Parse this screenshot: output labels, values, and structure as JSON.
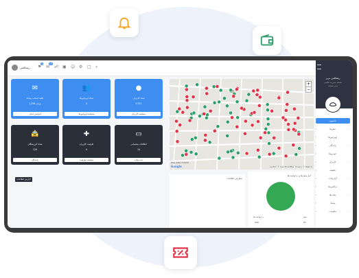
{
  "colors": {
    "accent": "#3d8ef0",
    "dark_tile": "#2b2f3a",
    "icon_orange": "#f5a623",
    "icon_green": "#2e9e6b",
    "icon_red": "#e0344b",
    "pie_green": "#34a853"
  },
  "floating_icons": [
    "bell-icon",
    "wallet-icon",
    "discount-ticket-icon"
  ],
  "topbar": {
    "user_name": "ريشاقس",
    "badge1": "4",
    "badge2": "10"
  },
  "tiles": [
    {
      "title": "باقية حساب رسانة",
      "value": "1,256 تومان",
      "foot": "افزایش اعتبار",
      "icon": "mail-icon"
    },
    {
      "title": "تعداد اوپراتورها",
      "value": "4",
      "foot": "مشاهده اوپراتورها",
      "icon": "users-icon"
    },
    {
      "title": "تعداد کاربران",
      "value": "3,521",
      "foot": "مشاهده کاربران",
      "icon": "user-icon"
    },
    {
      "title": "تعداد کرزیشگان",
      "value": "120",
      "foot": "رانندگان",
      "icon": "taxi-icon"
    },
    {
      "title": "ظرفیت کاربران",
      "value": "0",
      "foot": "مشاهده ظرفیت",
      "icon": "medical-box-icon"
    },
    {
      "title": "اطلاعات پشتیبانی",
      "value": "14",
      "foot": "ثبت تیکت",
      "icon": "chat-icon"
    }
  ],
  "map": {
    "attribution": "Leaflet | © OpenStreetMap, Imagery © Mapbox",
    "google": "Google",
    "scale": "Map data ©2018",
    "zoom_in": "+",
    "zoom_out": "−"
  },
  "report_button": "گزارش اطلاعات",
  "panels": {
    "orders_title": "سفارش اطلاعات",
    "chart_title": "آمار سفرها و درخواست‌ها"
  },
  "chart_data": {
    "type": "pie",
    "title": "آمار سفرها و درخواست‌ها",
    "series": [
      {
        "name": "درخواست‌ها",
        "values": [
          100
        ]
      }
    ],
    "legend": [
      "درخواست‌ها",
      "سفر"
    ],
    "footer": [
      "200",
      "75۰"
    ]
  },
  "sidebar": {
    "brand": "ریشاقس مریز",
    "sub1": "سامانه مدیریت تاکسی",
    "sub2": "مدیر سامانه",
    "items": [
      {
        "label": "داشبورد",
        "icon": "dashboard-icon"
      },
      {
        "label": "سفرها",
        "icon": "trips-icon"
      },
      {
        "label": "اوپراتورها",
        "icon": "operators-icon"
      },
      {
        "label": "رانندگان",
        "icon": "drivers-icon"
      },
      {
        "label": "خودروها",
        "icon": "cars-icon"
      },
      {
        "label": "کاربران",
        "icon": "users-icon"
      },
      {
        "label": "تخفیف",
        "icon": "discount-icon"
      },
      {
        "label": "گزارشات",
        "icon": "report-icon"
      },
      {
        "label": "تراکنش‌ها",
        "icon": "transactions-icon"
      },
      {
        "label": "تیکت‌ها",
        "icon": "tickets-icon"
      },
      {
        "label": "پیامک",
        "icon": "sms-icon"
      },
      {
        "label": "تنظیمات",
        "icon": "settings-icon"
      }
    ]
  }
}
